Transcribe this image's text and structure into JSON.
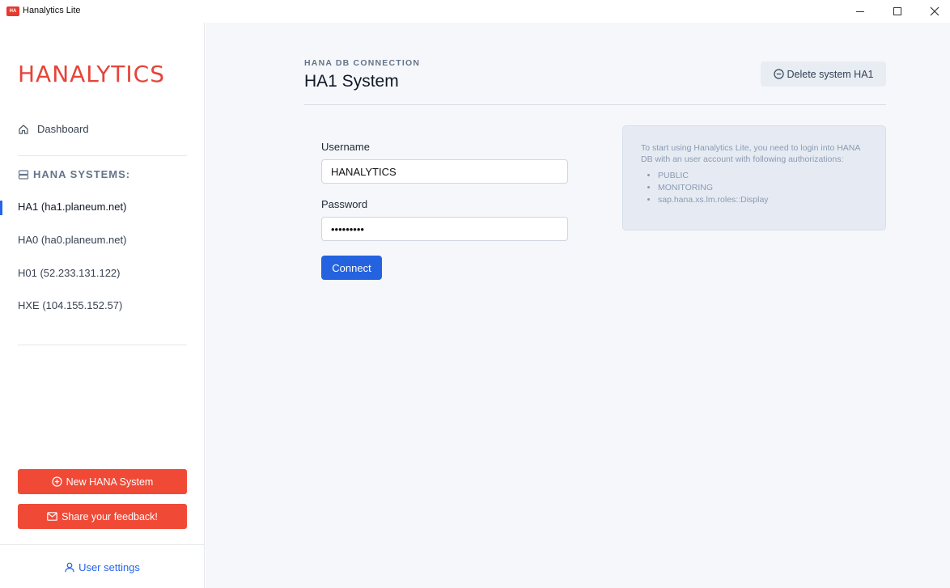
{
  "window": {
    "title": "Hanalytics Lite",
    "icon_text": "HA"
  },
  "sidebar": {
    "logo": "HANALYTICS",
    "dashboard_label": "Dashboard",
    "systems_header": "HANA SYSTEMS:",
    "systems": [
      {
        "label": "HA1 (ha1.planeum.net)",
        "active": true
      },
      {
        "label": "HA0 (ha0.planeum.net)",
        "active": false
      },
      {
        "label": "H01 (52.233.131.122)",
        "active": false
      },
      {
        "label": "HXE (104.155.152.57)",
        "active": false
      }
    ],
    "new_system_label": "New HANA System",
    "feedback_label": "Share your feedback!",
    "user_settings_label": "User settings"
  },
  "main": {
    "kicker": "HANA DB CONNECTION",
    "title": "HA1 System",
    "delete_label": "Delete system HA1",
    "username_label": "Username",
    "username_value": "HANALYTICS",
    "password_label": "Password",
    "password_value": "•••••••••",
    "connect_label": "Connect",
    "info": {
      "text": "To start using Hanalytics Lite, you need to login into HANA DB with an user account with following authorizations:",
      "items": [
        "PUBLIC",
        "MONITORING",
        "sap.hana.xs.lm.roles::Display"
      ]
    }
  },
  "colors": {
    "accent_red": "#f04a37",
    "accent_blue": "#2462e0",
    "main_bg": "#f5f7fa"
  }
}
